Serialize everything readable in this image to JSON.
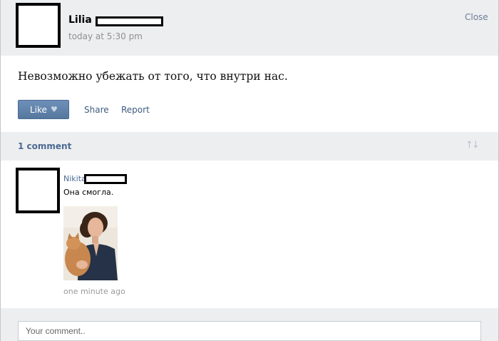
{
  "post": {
    "author": "Lilia",
    "time": "today at 5:30 pm",
    "close_label": "Close",
    "text": "Невозможно убежать от того, что внутри нас.",
    "actions": {
      "like_label": "Like",
      "share_label": "Share",
      "report_label": "Report"
    }
  },
  "comments": {
    "count_label": "1 comment",
    "items": [
      {
        "author": "Nikita",
        "text": "Она смогла.",
        "time": "one minute ago"
      }
    ]
  },
  "composer": {
    "placeholder": "Your comment.."
  },
  "icons": {
    "like": "heart-icon",
    "sort": "sort-icon"
  },
  "colors": {
    "accent": "#4c6a92",
    "like_button": "#5d7fa8",
    "header_bg": "#edeef0"
  }
}
